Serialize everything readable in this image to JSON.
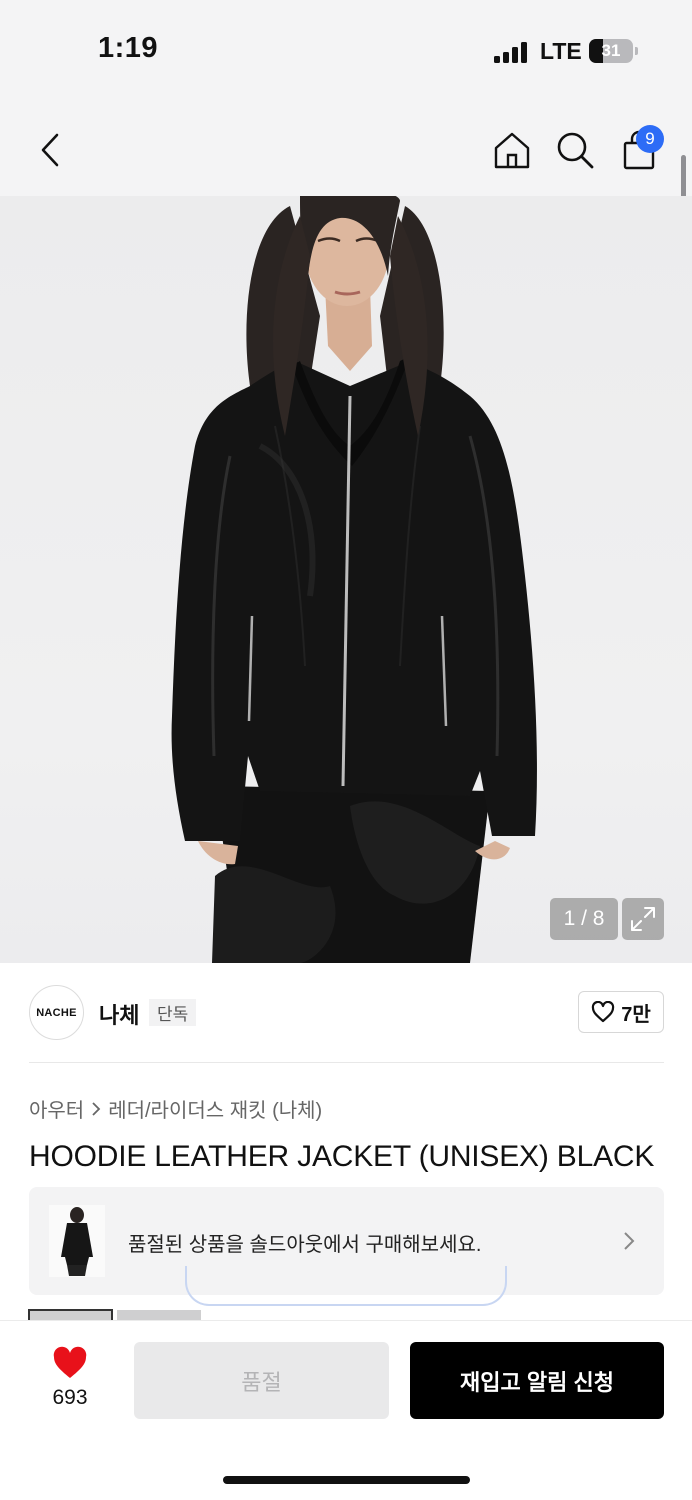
{
  "status_bar": {
    "time": "1:19",
    "network": "LTE",
    "battery": "31",
    "battery_level": 0.31
  },
  "nav": {
    "cart_count": "9"
  },
  "gallery": {
    "counter": "1 / 8",
    "current_photo": 1,
    "total_photos": 8
  },
  "brand": {
    "logo_text": "NACHE",
    "name": "나체",
    "tag": "단독",
    "like_count": "7만"
  },
  "breadcrumb": {
    "category": "아우터",
    "subcategory": "레더/라이더스 재킷 (나체)"
  },
  "product": {
    "title": "HOODIE LEATHER JACKET (UNISEX) BLACK"
  },
  "soldout_banner": {
    "text": "품절된 상품을 솔드아웃에서 구매해보세요."
  },
  "bottom_bar": {
    "like_count": "693",
    "soldout_label": "품절",
    "restock_label": "재입고 알림 신청"
  },
  "colors": {
    "accent_blue": "#2d6cf6",
    "heart_red": "#e8111a",
    "primary_black": "#000000"
  }
}
